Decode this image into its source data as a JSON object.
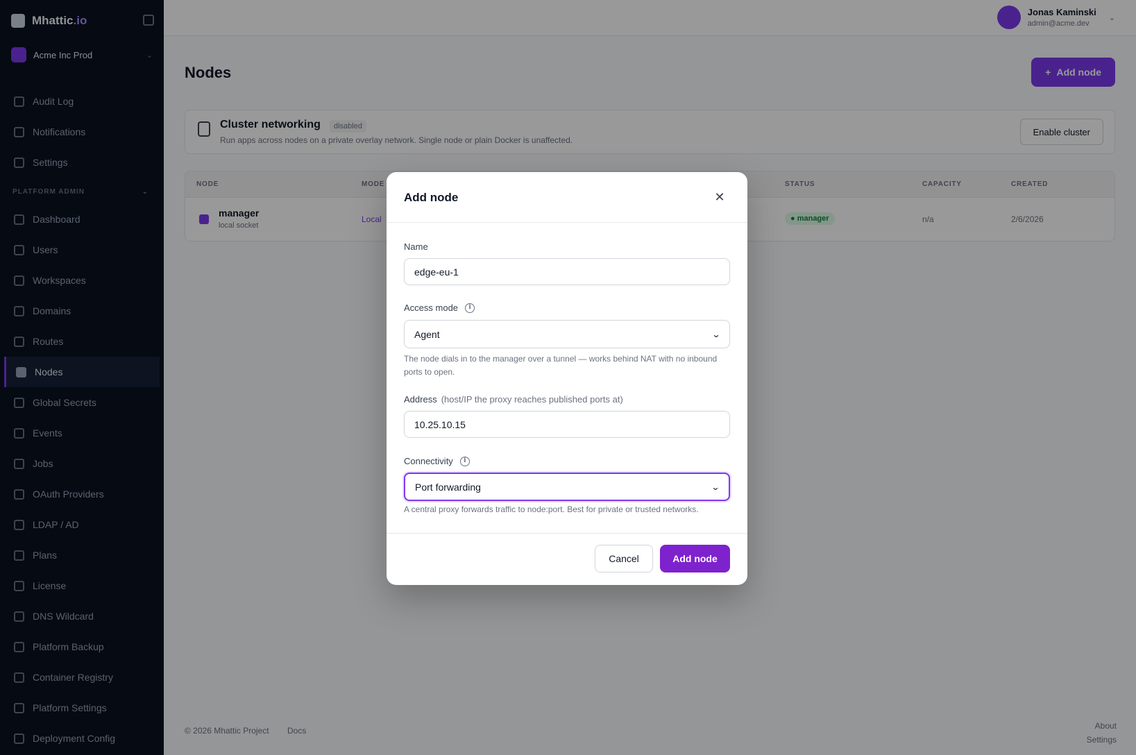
{
  "app": {
    "logo_text": "Mhattic",
    "logo_accent": ".io",
    "org_name": "Acme Inc Prod"
  },
  "sidebar": {
    "items_top": [
      {
        "label": "Audit Log",
        "icon": "log-icon"
      },
      {
        "label": "Notifications",
        "icon": "bell-icon"
      },
      {
        "label": "Settings",
        "icon": "gear-icon"
      }
    ],
    "section_label": "PLATFORM ADMIN",
    "items": [
      {
        "label": "Dashboard",
        "icon": "dashboard-icon"
      },
      {
        "label": "Users",
        "icon": "users-icon"
      },
      {
        "label": "Workspaces",
        "icon": "workspace-icon"
      },
      {
        "label": "Domains",
        "icon": "globe-icon"
      },
      {
        "label": "Routes",
        "icon": "route-icon"
      },
      {
        "label": "Nodes",
        "icon": "server-icon",
        "active": true
      },
      {
        "label": "Global Secrets",
        "icon": "key-icon"
      },
      {
        "label": "Events",
        "icon": "events-icon"
      },
      {
        "label": "Jobs",
        "icon": "jobs-icon"
      },
      {
        "label": "OAuth Providers",
        "icon": "oauth-icon"
      },
      {
        "label": "LDAP / AD",
        "icon": "directory-icon"
      },
      {
        "label": "Plans",
        "icon": "plans-icon"
      },
      {
        "label": "License",
        "icon": "license-icon"
      },
      {
        "label": "DNS Wildcard",
        "icon": "dns-icon"
      },
      {
        "label": "Platform Backup",
        "icon": "backup-icon"
      },
      {
        "label": "Container Registry",
        "icon": "registry-icon"
      },
      {
        "label": "Platform Settings",
        "icon": "settings-icon"
      },
      {
        "label": "Deployment Config",
        "icon": "config-icon"
      }
    ]
  },
  "user": {
    "name": "Jonas Kaminski",
    "email": "admin@acme.dev"
  },
  "page": {
    "title": "Nodes",
    "add_button": "Add node"
  },
  "cluster_card": {
    "title": "Cluster networking",
    "badge": "disabled",
    "description": "Run apps across nodes on a private overlay network. Single node or plain Docker is unaffected.",
    "button": "Enable cluster"
  },
  "table": {
    "headers": [
      "NODE",
      "MODE",
      "STATUS",
      "CAPACITY",
      "CREATED"
    ],
    "rows": [
      {
        "name": "manager",
        "sub": "local socket",
        "mode": "Local",
        "status": "● manager",
        "capacity": "n/a",
        "created": "2/6/2026"
      }
    ]
  },
  "footer": {
    "copyright": "© 2026 Mhattic Project",
    "link": "Docs",
    "right_1": "About",
    "right_2": "Settings"
  },
  "modal": {
    "title": "Add node",
    "name_label": "Name",
    "name_value": "edge-eu-1",
    "access_mode_label": "Access mode",
    "access_mode_value": "Agent",
    "access_mode_help": "The node dials in to the manager over a tunnel — works behind NAT with no inbound ports to open.",
    "address_label": "Address",
    "address_hint": "(host/IP the proxy reaches published ports at)",
    "address_value": "10.25.10.15",
    "connectivity_label": "Connectivity",
    "connectivity_value": "Port forwarding",
    "connectivity_help": "A central proxy forwards traffic to node:port. Best for private or trusted networks.",
    "cancel_label": "Cancel",
    "submit_label": "Add node"
  },
  "colors": {
    "accent": "#7c3aed",
    "submit": "#7e22ce",
    "sidebar_bg": "#0b1220"
  }
}
